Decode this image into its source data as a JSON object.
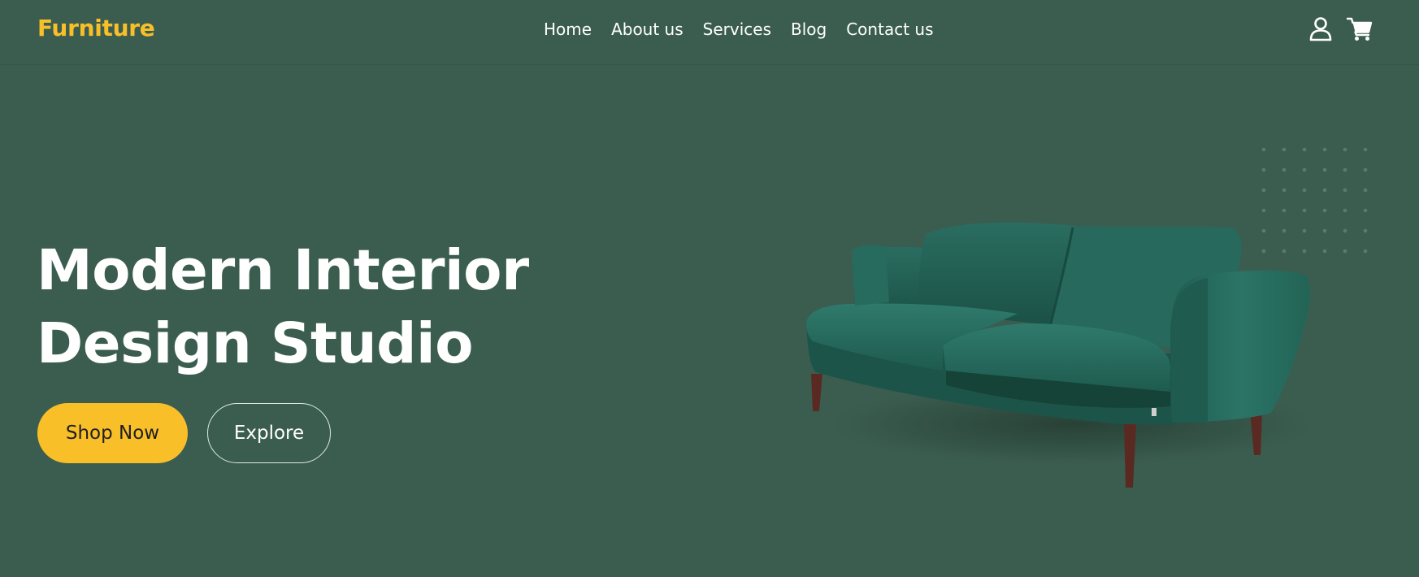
{
  "header": {
    "brand": "Furniture",
    "nav": [
      {
        "label": "Home"
      },
      {
        "label": "About us"
      },
      {
        "label": "Services"
      },
      {
        "label": "Blog"
      },
      {
        "label": "Contact us"
      }
    ],
    "icons": [
      "user-icon",
      "cart-icon"
    ]
  },
  "hero": {
    "title_line1": "Modern Interior",
    "title_line2": "Design Studio",
    "primary_button": "Shop Now",
    "secondary_button": "Explore",
    "image": "green-velvet-sofa"
  },
  "colors": {
    "background": "#3b5d50",
    "accent": "#f9bf29",
    "text": "#ffffff"
  }
}
